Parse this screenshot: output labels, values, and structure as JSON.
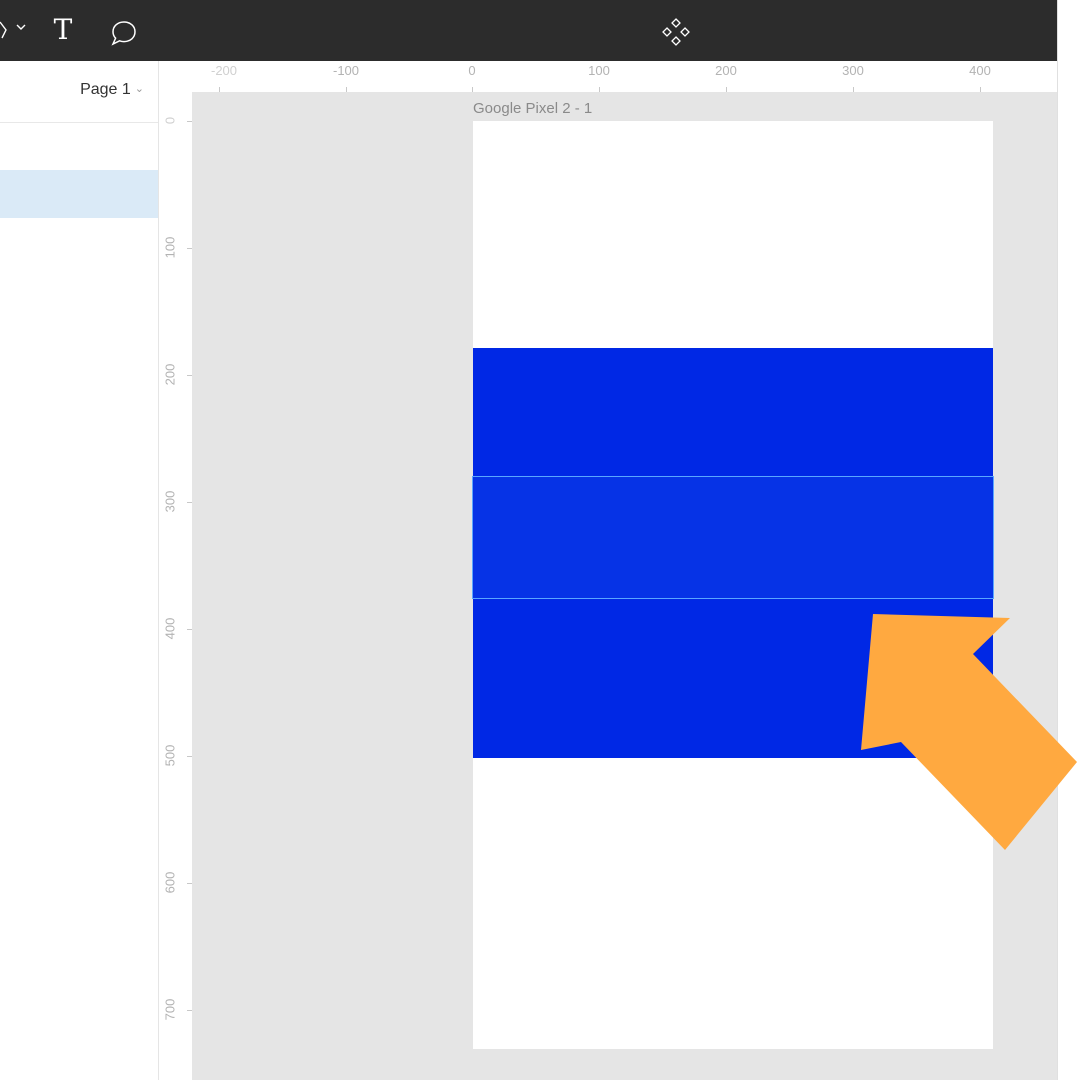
{
  "toolbar": {
    "text_tool_glyph": "T",
    "icons": [
      "pen-tool-icon",
      "chevron-down-icon",
      "text-tool-icon",
      "comment-icon",
      "component-icon"
    ]
  },
  "left_panel": {
    "page_selector": "Page 1"
  },
  "rulers": {
    "top": [
      "-200",
      "-100",
      "0",
      "100",
      "200",
      "300",
      "400"
    ],
    "left": [
      "0",
      "100",
      "200",
      "300",
      "400",
      "500",
      "600",
      "700"
    ]
  },
  "canvas": {
    "frame_name": "Google Pixel 2 - 1",
    "fill_color": "#0028e5",
    "selection_color": "#5aa7ff",
    "arrow_color": "#ffa940"
  }
}
